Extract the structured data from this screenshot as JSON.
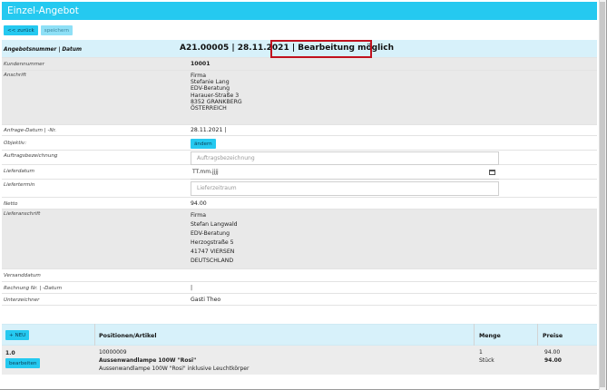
{
  "window": {
    "title": "Einzel-Angebot"
  },
  "toolbar": {
    "back_label": "<< zurück",
    "save_label": "speichern"
  },
  "header": {
    "label": "Angebotsnummer | Datum",
    "number_date": "A21.00005 | 28.11.2021 |",
    "status": "Bearbeitung möglich"
  },
  "fields": {
    "customer_number_label": "Kundennummer",
    "customer_number": "10001",
    "address_label": "Anschrift",
    "address_lines": [
      "Firma",
      "Stefanie Lang",
      "EDV-Beratung",
      "Harauer-Straße 3",
      "8352 GRANKBERG",
      "ÖSTERREICH"
    ],
    "inquiry_label": "Anfrage-Datum | -Nr.",
    "inquiry_value": "28.11.2021 |",
    "object_label": "Objektiv:",
    "object_button": "ändern",
    "order_desc_label": "Auftragsbezeichnung",
    "order_desc_placeholder": "Auftragsbezeichnung",
    "delivery_date_label": "Lieferdatum",
    "delivery_date_value": "TT.mm.jjjj",
    "delivery_term_label": "Liefertermin",
    "delivery_term_placeholder": "Lieferzeitraum",
    "net_label": "Netto",
    "net_value": "94.00",
    "delivery_address_label": "Lieferanschrift",
    "delivery_address_lines": [
      "Firma",
      "Stefan Langwald",
      "EDV-Beratung",
      "Herzogstraße 5",
      "41747 VIERSEN",
      "DEUTSCHLAND"
    ],
    "shipping_date_label": "Versanddatum",
    "invoice_label": "Rechnung Nr. | -Datum",
    "invoice_value": "|",
    "signer_label": "Unterzeichner",
    "signer_value": "Gasti Theo"
  },
  "positions": {
    "new_button": "+ NEU",
    "columns": [
      "Positionen/Artikel",
      "Menge",
      "Preise"
    ],
    "rows": [
      {
        "pos": "1.0",
        "edit_button": "bearbeiten",
        "article_number": "10000009",
        "article_name": "Aussenwandlampe 100W \"Rosi\"",
        "article_desc": "Aussenwandlampe 100W \"Rosi\" inklusive Leuchtkörper",
        "quantity": "1",
        "unit": "Stück",
        "price": "94.00",
        "total": "94.00"
      }
    ]
  },
  "colors": {
    "accent": "#25c9f0",
    "highlight_box": "#c1121f"
  }
}
